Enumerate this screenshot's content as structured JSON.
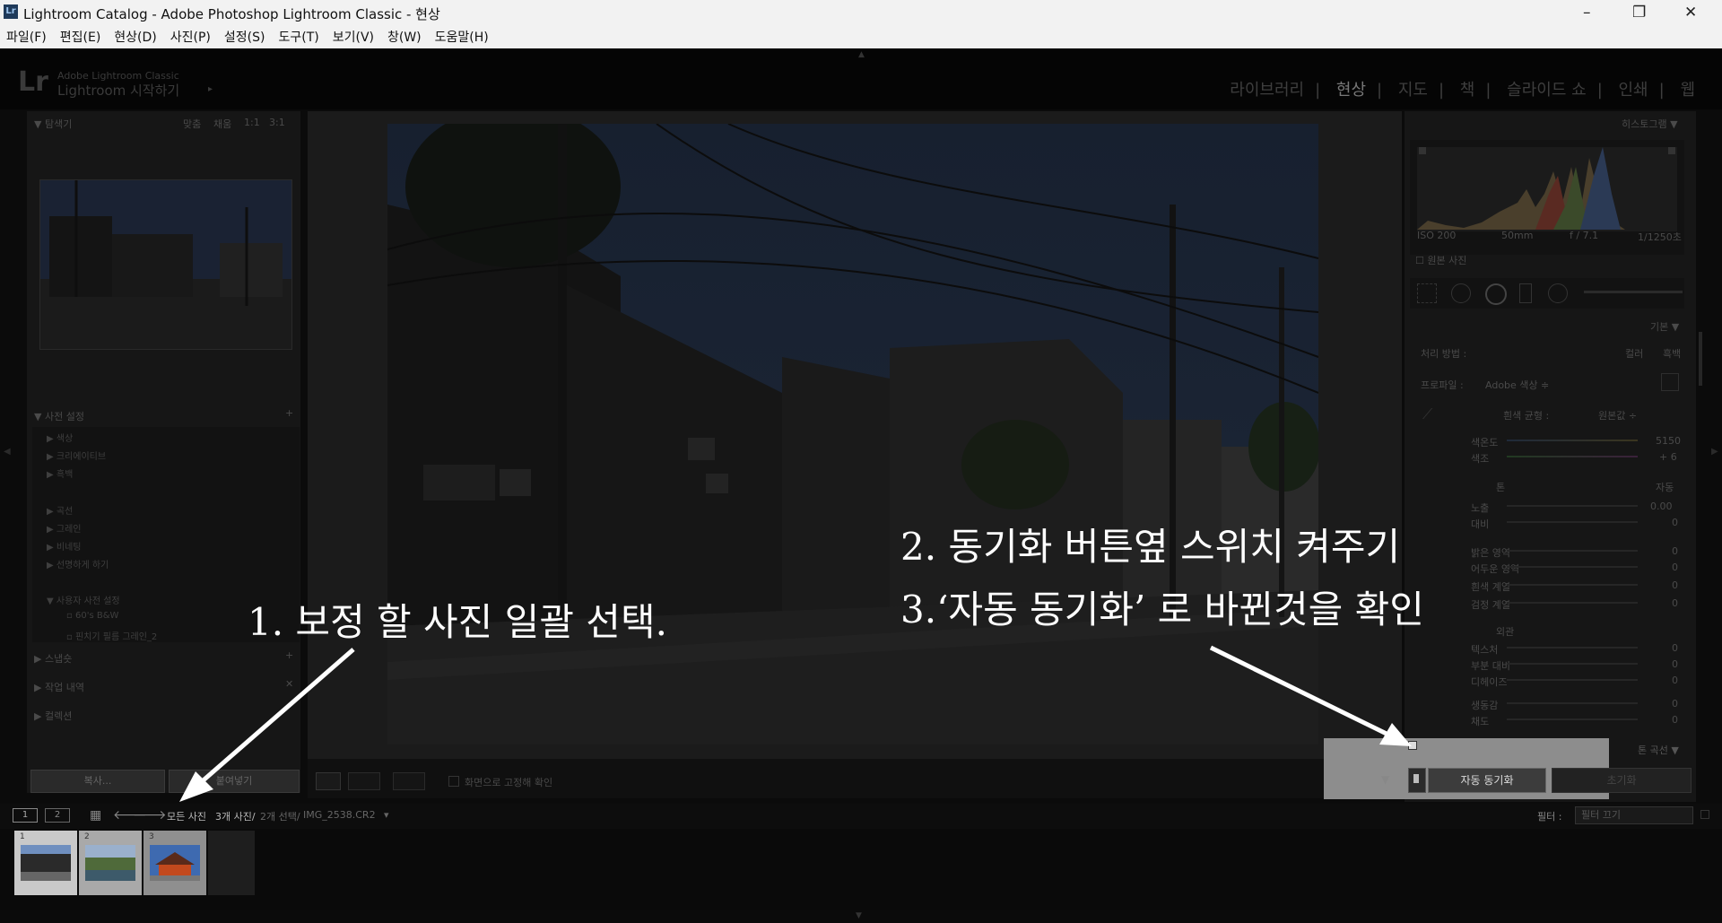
{
  "window": {
    "icon_label": "Lr",
    "title": "Lightroom Catalog - Adobe Photoshop Lightroom Classic - 현상",
    "minimize": "–",
    "restore": "❐",
    "close": "✕"
  },
  "menu": [
    "파일(F)",
    "편집(E)",
    "현상(D)",
    "사진(P)",
    "설정(S)",
    "도구(T)",
    "보기(V)",
    "창(W)",
    "도움말(H)"
  ],
  "identity": {
    "logo": "Lr",
    "brand_small": "Adobe Lightroom Classic",
    "brand_large": "Lightroom 시작하기",
    "arrow": "▸"
  },
  "modules": [
    {
      "label": "라이브러리",
      "active": false
    },
    {
      "label": "현상",
      "active": true
    },
    {
      "label": "지도",
      "active": false
    },
    {
      "label": "책",
      "active": false
    },
    {
      "label": "슬라이드 쇼",
      "active": false
    },
    {
      "label": "인쇄",
      "active": false
    },
    {
      "label": "웹",
      "active": false
    }
  ],
  "module_separator": "|",
  "left_panel": {
    "navigator_title": "탐색기",
    "nav_zoom": [
      "맞춤",
      "채움",
      "1:1",
      "3:1"
    ],
    "presets_title": "사전 설정",
    "presets_add": "+",
    "presets": [
      "색상",
      "크리에이티브",
      "흑백",
      "곡선",
      "그레인",
      "비네팅",
      "선명하게 하기"
    ],
    "user_presets_title": "사용자 사전 설정",
    "user_presets": [
      "60's B&W",
      "핀치기 필름 그레인_2"
    ],
    "snapshots": "스냅숏",
    "history": "작업 내역",
    "collections": "컬렉션",
    "copy_button": "복사...",
    "paste_button": "붙여넣기"
  },
  "right_panel": {
    "histogram_title": "히스토그램",
    "exif": [
      "ISO 200",
      "50mm",
      "f / 7.1",
      "1/1250초"
    ],
    "original_photo": "원본 사진",
    "basic_title": "기본",
    "treatment_label": "처리 방법 :",
    "treatment_color": "컬러",
    "treatment_bw": "흑백",
    "profile_label": "프로파일 :",
    "profile_value": "Adobe 색상 ≑",
    "wb_label": "흰색 균형 :",
    "wb_value": "원본값 ÷",
    "temp_label": "색온도",
    "temp_value": "5150",
    "tint_label": "색조",
    "tint_value": "+ 6",
    "tone_label": "톤",
    "tone_auto": "자동",
    "exposure_label": "노출",
    "exposure_value": "0.00",
    "tone_sliders": [
      {
        "label": "대비",
        "value": "0"
      },
      {
        "label": "밝은 영역",
        "value": "0"
      },
      {
        "label": "어두운 영역",
        "value": "0"
      },
      {
        "label": "흰색 계열",
        "value": "0"
      },
      {
        "label": "검정 계열",
        "value": "0"
      }
    ],
    "presence_label": "외관",
    "presence_sliders": [
      {
        "label": "텍스처",
        "value": "0"
      },
      {
        "label": "부분 대비",
        "value": "0"
      },
      {
        "label": "디헤이즈",
        "value": "0"
      },
      {
        "label": "생동감",
        "value": "0"
      },
      {
        "label": "채도",
        "value": "0"
      }
    ],
    "tone_curve_title": "톤 곡선",
    "auto_sync_button": "자동 동기화",
    "reset_button": "초기화"
  },
  "toolbar": {
    "lock_label": "화면으로 고정해 확인"
  },
  "filmbar": {
    "view1": "1",
    "view2": "2",
    "all_photos": "모든 사진",
    "count": "3개 사진/",
    "selected": "2개 선택/",
    "filename": "IMG_2538.CR2",
    "dropdown": "▾",
    "filter_label": "필터 :",
    "filter_value": "필터 끄기"
  },
  "thumbnails": [
    {
      "number": "1",
      "selected": true
    },
    {
      "number": "2",
      "selected": true
    },
    {
      "number": "3",
      "selected": false
    }
  ],
  "annotations": {
    "step1": "1. 보정 할 사진 일괄 선택.",
    "step2": "2. 동기화 버튼옆 스위치 켜주기",
    "step3": "3.‘자동 동기화’ 로 바뀐것을 확인"
  },
  "colors": {
    "annotation": "#ffffff",
    "panel": "#161616",
    "background": "#0b0b0b"
  }
}
